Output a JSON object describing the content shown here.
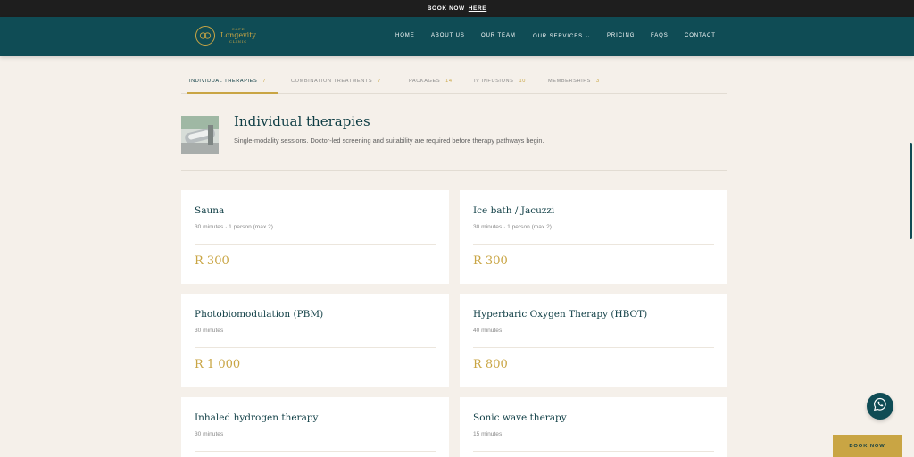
{
  "topbar": {
    "text": "BOOK NOW",
    "link": "HERE"
  },
  "brand": {
    "line1": "CAPE",
    "line2": "Longevity",
    "line3": "CLINIC"
  },
  "nav": {
    "items": [
      "HOME",
      "ABOUT US",
      "OUR TEAM",
      "OUR SERVICES",
      "PRICING",
      "FAQS",
      "CONTACT"
    ],
    "services_chevron": "⌄"
  },
  "tabs": [
    {
      "label": "INDIVIDUAL THERAPIES",
      "count": "7",
      "active": true
    },
    {
      "label": "COMBINATION TREATMENTS",
      "count": "7",
      "active": false
    },
    {
      "label": "PACKAGES",
      "count": "14",
      "active": false
    },
    {
      "label": "IV INFUSIONS",
      "count": "10",
      "active": false
    },
    {
      "label": "MEMBERSHIPS",
      "count": "3",
      "active": false
    }
  ],
  "intro": {
    "title": "Individual therapies",
    "description": "Single-modality sessions. Doctor-led screening and suitability are required before therapy pathways begin."
  },
  "cards": [
    {
      "title": "Sauna",
      "meta": "30 minutes · 1 person (max 2)",
      "price": "R 300"
    },
    {
      "title": "Ice bath / Jacuzzi",
      "meta": "30 minutes · 1 person (max 2)",
      "price": "R 300"
    },
    {
      "title": "Photobiomodulation (PBM)",
      "meta": "30 minutes",
      "price": "R 1 000"
    },
    {
      "title": "Hyperbaric Oxygen Therapy (HBOT)",
      "meta": "40 minutes",
      "price": "R 800"
    },
    {
      "title": "Inhaled hydrogen therapy",
      "meta": "30 minutes",
      "price": ""
    },
    {
      "title": "Sonic wave therapy",
      "meta": "15 minutes",
      "price": ""
    }
  ],
  "floating": {
    "whatsapp_icon": "whatsapp-icon",
    "book_now": "BOOK NOW"
  },
  "colors": {
    "teal": "#0f4c55",
    "gold": "#c9a544",
    "background": "#f5f0ea",
    "topbar": "#1e1e1e"
  }
}
